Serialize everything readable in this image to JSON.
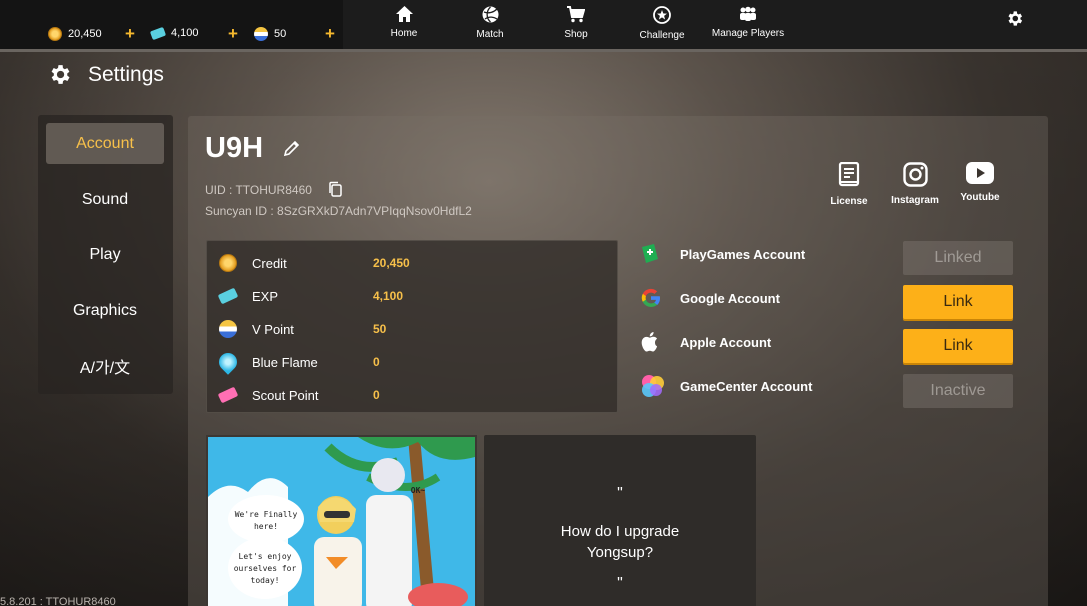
{
  "currencies": [
    {
      "icon": "coin-icon",
      "value": "20,450"
    },
    {
      "icon": "ticket-icon",
      "value": "4,100"
    },
    {
      "icon": "v-point-icon",
      "value": "50"
    }
  ],
  "plus_label": "+",
  "nav": [
    {
      "label": "Home",
      "icon": "home-icon"
    },
    {
      "label": "Match",
      "icon": "ball-icon"
    },
    {
      "label": "Shop",
      "icon": "cart-icon"
    },
    {
      "label": "Challenge",
      "icon": "star-circle-icon"
    },
    {
      "label": "Manage Players",
      "icon": "players-icon"
    }
  ],
  "page_title": "Settings",
  "sidebar": [
    {
      "label": "Account",
      "active": true
    },
    {
      "label": "Sound"
    },
    {
      "label": "Play"
    },
    {
      "label": "Graphics"
    },
    {
      "label": "A/가/文"
    }
  ],
  "profile": {
    "name": "U9H",
    "uid": "UID : TTOHUR8460",
    "suncyan_id": "Suncyan ID : 8SzGRXkD7Adn7VPIqqNsov0HdfL2"
  },
  "social": [
    {
      "label": "License",
      "icon": "book-icon"
    },
    {
      "label": "Instagram",
      "icon": "instagram-icon"
    },
    {
      "label": "Youtube",
      "icon": "youtube-icon"
    }
  ],
  "stats": [
    {
      "label": "Credit",
      "value": "20,450",
      "icon": "coin-icon"
    },
    {
      "label": "EXP",
      "value": "4,100",
      "icon": "ticket-icon"
    },
    {
      "label": "V Point",
      "value": "50",
      "icon": "v-point-icon"
    },
    {
      "label": "Blue Flame",
      "value": "0",
      "icon": "blue-flame-icon"
    },
    {
      "label": "Scout Point",
      "value": "0",
      "icon": "scout-ticket-icon"
    }
  ],
  "accounts": [
    {
      "label": "PlayGames Account",
      "button": "Linked",
      "state": "disabled",
      "icon": "playgames-icon"
    },
    {
      "label": "Google Account",
      "button": "Link",
      "state": "active",
      "icon": "google-icon"
    },
    {
      "label": "Apple Account",
      "button": "Link",
      "state": "active",
      "icon": "apple-icon"
    },
    {
      "label": "GameCenter Account",
      "button": "Inactive",
      "state": "disabled",
      "icon": "gamecenter-icon"
    }
  ],
  "card_image_text": {
    "bubble1": "We're Finally here!",
    "bubble2": "Let's enjoy ourselves for today!",
    "bubble3": "OK~"
  },
  "tip": {
    "open_quote": "\"",
    "text_line1": "How do I upgrade",
    "text_line2": "Yongsup?",
    "close_quote": "\""
  },
  "version": "5.8.201 : TTOHUR8460",
  "colors": {
    "accent": "#f7c04a",
    "button": "#fdb018"
  }
}
